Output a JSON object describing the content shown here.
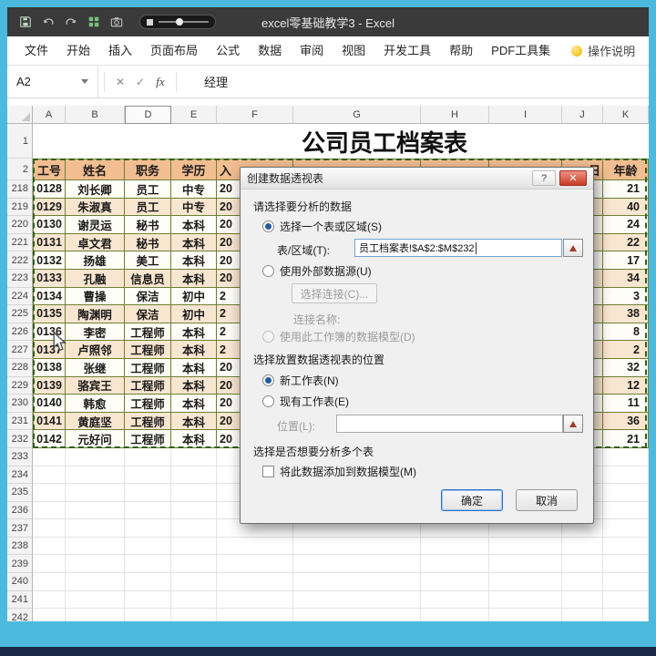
{
  "window": {
    "title": "excel零基础教学3 - Excel"
  },
  "ribbon": {
    "tabs": [
      "文件",
      "开始",
      "插入",
      "页面布局",
      "公式",
      "数据",
      "审阅",
      "视图",
      "开发工具",
      "帮助",
      "PDF工具集"
    ],
    "tell_me": "操作说明"
  },
  "formula_bar": {
    "name_box": "A2",
    "value": "经理",
    "icons": {
      "cancel": "✕",
      "confirm": "✓",
      "fx": "fx"
    }
  },
  "sheet": {
    "title": "公司员工档案表",
    "column_headers": [
      "A",
      "B",
      "D",
      "E",
      "F",
      "G",
      "H",
      "I",
      "J",
      "K"
    ],
    "row1_number": "1",
    "row2_number": "2",
    "table_header": {
      "id": "工号",
      "name": "姓名",
      "title": "职务",
      "edu": "学历",
      "hire": "入",
      "day": "日",
      "age": "年龄"
    },
    "rows": [
      {
        "n": "218",
        "id": "0128",
        "name": "刘长卿",
        "title": "员工",
        "edu": "中专",
        "hire": "20",
        "age": "21"
      },
      {
        "n": "219",
        "id": "0129",
        "name": "朱淑真",
        "title": "员工",
        "edu": "中专",
        "hire": "20",
        "age": "40"
      },
      {
        "n": "220",
        "id": "0130",
        "name": "谢灵运",
        "title": "秘书",
        "edu": "本科",
        "hire": "20",
        "age": "24"
      },
      {
        "n": "221",
        "id": "0131",
        "name": "卓文君",
        "title": "秘书",
        "edu": "本科",
        "hire": "20",
        "age": "22"
      },
      {
        "n": "222",
        "id": "0132",
        "name": "扬雄",
        "title": "美工",
        "edu": "本科",
        "hire": "20",
        "age": "17"
      },
      {
        "n": "223",
        "id": "0133",
        "name": "孔融",
        "title": "信息员",
        "edu": "本科",
        "hire": "20",
        "age": "34"
      },
      {
        "n": "224",
        "id": "0134",
        "name": "曹操",
        "title": "保洁",
        "edu": "初中",
        "hire": "2",
        "age": "3"
      },
      {
        "n": "225",
        "id": "0135",
        "name": "陶渊明",
        "title": "保洁",
        "edu": "初中",
        "hire": "2",
        "age": "38"
      },
      {
        "n": "226",
        "id": "0136",
        "name": "李密",
        "title": "工程师",
        "edu": "本科",
        "hire": "2",
        "age": "8"
      },
      {
        "n": "227",
        "id": "0137",
        "name": "卢照邻",
        "title": "工程师",
        "edu": "本科",
        "hire": "2",
        "age": "2"
      },
      {
        "n": "228",
        "id": "0138",
        "name": "张继",
        "title": "工程师",
        "edu": "本科",
        "hire": "20",
        "age": "32"
      },
      {
        "n": "229",
        "id": "0139",
        "name": "骆宾王",
        "title": "工程师",
        "edu": "本科",
        "hire": "20",
        "age": "12"
      },
      {
        "n": "230",
        "id": "0140",
        "name": "韩愈",
        "title": "工程师",
        "edu": "本科",
        "hire": "20",
        "age": "11"
      },
      {
        "n": "231",
        "id": "0141",
        "name": "黄庭坚",
        "title": "工程师",
        "edu": "本科",
        "hire": "20",
        "age": "36"
      },
      {
        "n": "232",
        "id": "0142",
        "name": "元好问",
        "title": "工程师",
        "edu": "本科",
        "hire": "20",
        "age": "21"
      }
    ],
    "empty_rows": [
      "233",
      "234",
      "235",
      "236",
      "237",
      "238",
      "239",
      "240",
      "241",
      "242"
    ]
  },
  "dialog": {
    "title": "创建数据透视表",
    "help_icon": "?",
    "close_icon": "✕",
    "section1": "请选择要分析的数据",
    "radio_table_range": "选择一个表或区域(S)",
    "range_label": "表/区域(T):",
    "range_value": "员工档案表!$A$2:$M$232",
    "radio_external": "使用外部数据源(U)",
    "choose_connection": "选择连接(C)...",
    "connection_name": "连接名称:",
    "radio_data_model": "使用此工作簿的数据模型(D)",
    "section2": "选择放置数据透视表的位置",
    "radio_new_sheet": "新工作表(N)",
    "radio_existing_sheet": "现有工作表(E)",
    "location_label": "位置(L):",
    "location_value": "",
    "section3": "选择是否想要分析多个表",
    "checkbox_add_model": "将此数据添加到数据模型(M)",
    "ok": "确定",
    "cancel": "取消"
  },
  "colors": {
    "frame": "#4bbade",
    "bottom_navy": "#1d2a47",
    "table_border": "#6e7f35",
    "table_header_fill": "#f2bd90",
    "band_fill": "#f9e6d0"
  }
}
